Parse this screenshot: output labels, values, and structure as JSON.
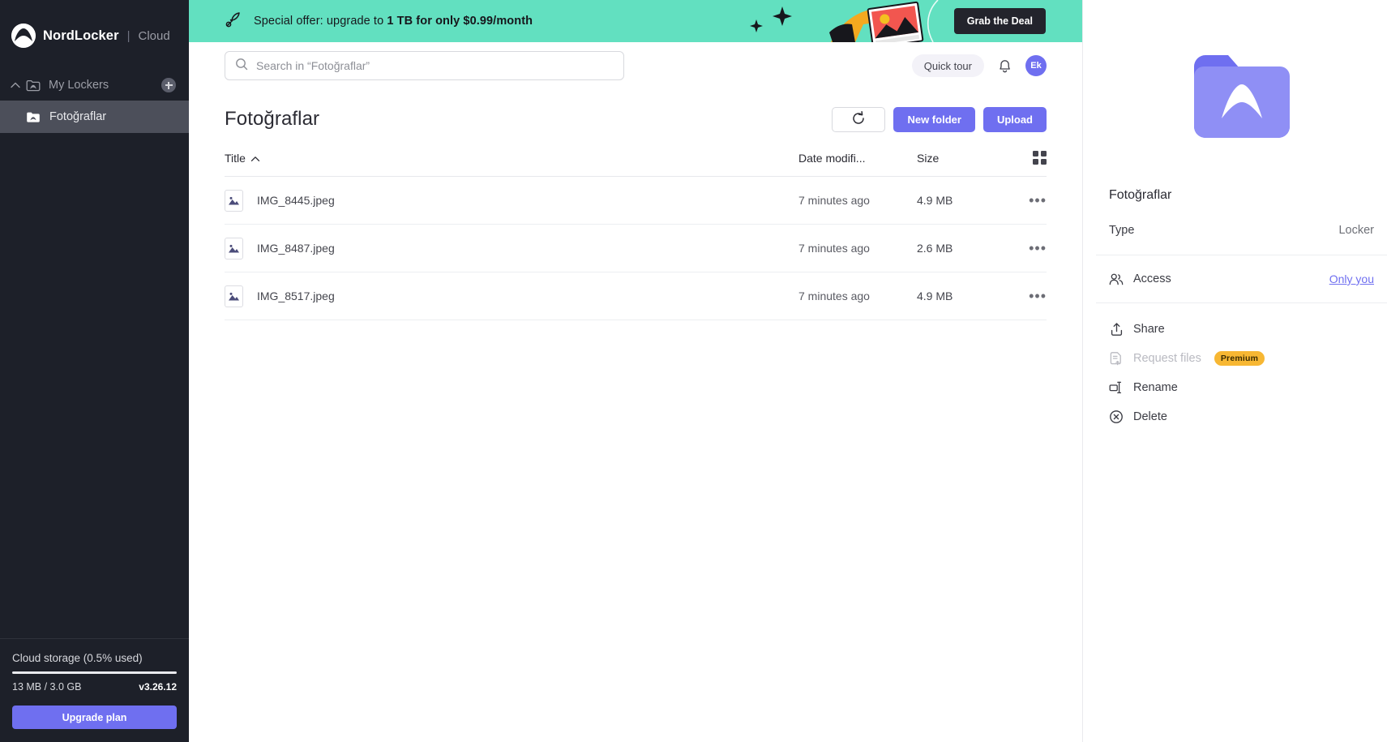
{
  "sidebar": {
    "brand": {
      "name": "NordLocker",
      "separator": "|",
      "sub": "Cloud",
      "logo_icon": "nordlocker-mountain-icon"
    },
    "group": {
      "label": "My Lockers",
      "icon": "locker-folder-icon",
      "chevron_icon": "chevron-up-icon",
      "add_icon": "plus-circle-icon"
    },
    "items": [
      {
        "label": "Fotoğraflar",
        "icon": "locker-folder-icon",
        "active": true
      }
    ],
    "storage": {
      "label": "Cloud storage (0.5% used)",
      "used_text": "13 MB / 3.0 GB",
      "percent": 0.5,
      "version": "v3.26.12",
      "upgrade_label": "Upgrade plan"
    }
  },
  "banner": {
    "icon": "rocket-icon",
    "text_prefix": "Special offer: upgrade to ",
    "text_bold": "1 TB for only $0.99/month",
    "cta_label": "Grab the Deal",
    "bg_color": "#62e0c0",
    "cta_bg": "#23242c"
  },
  "topbar": {
    "search": {
      "placeholder": "Search in “Fotoğraflar”",
      "value": "",
      "icon": "search-icon"
    },
    "quick_tour_label": "Quick tour",
    "bell_icon": "bell-icon",
    "avatar_initials": "Ek"
  },
  "page": {
    "title": "Fotoğraflar",
    "refresh_icon": "refresh-icon",
    "new_folder_label": "New folder",
    "upload_label": "Upload",
    "grid_view_icon": "grid-view-icon"
  },
  "table": {
    "headers": {
      "title": "Title",
      "date": "Date modifi...",
      "size": "Size"
    },
    "sort_icon": "chevron-up-icon",
    "rows": [
      {
        "name": "IMG_8445.jpeg",
        "date": "7 minutes ago",
        "size": "4.9 MB",
        "icon": "image-file-icon",
        "more_icon": "more-horizontal-icon",
        "more_label": "•••"
      },
      {
        "name": "IMG_8487.jpeg",
        "date": "7 minutes ago",
        "size": "2.6 MB",
        "icon": "image-file-icon",
        "more_icon": "more-horizontal-icon",
        "more_label": "•••"
      },
      {
        "name": "IMG_8517.jpeg",
        "date": "7 minutes ago",
        "size": "4.9 MB",
        "icon": "image-file-icon",
        "more_icon": "more-horizontal-icon",
        "more_label": "•••"
      }
    ]
  },
  "details": {
    "hero_icon": "large-locker-folder-icon",
    "name": "Fotoğraflar",
    "type_label": "Type",
    "type_value": "Locker",
    "access_label": "Access",
    "access_value": "Only you",
    "actions": [
      {
        "label": "Share",
        "icon": "share-upload-icon",
        "disabled": false,
        "badge": ""
      },
      {
        "label": "Request files",
        "icon": "request-files-icon",
        "disabled": true,
        "badge": "Premium"
      },
      {
        "label": "Rename",
        "icon": "rename-icon",
        "disabled": false,
        "badge": ""
      },
      {
        "label": "Delete",
        "icon": "delete-circle-icon",
        "disabled": false,
        "badge": ""
      }
    ]
  },
  "colors": {
    "accent": "#6f6ff0",
    "banner": "#62e0c0",
    "premium": "#f7b733",
    "sidebar": "#1d2029"
  }
}
